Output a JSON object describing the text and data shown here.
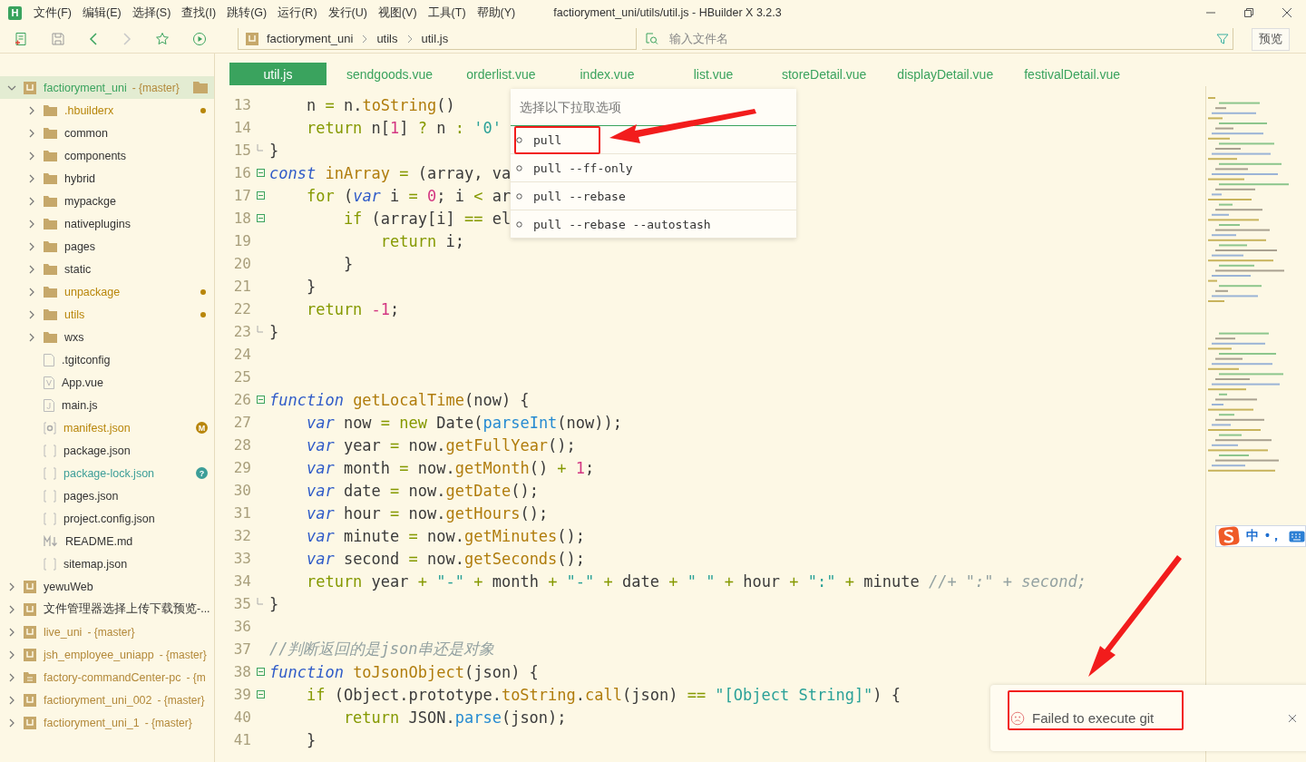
{
  "window": {
    "logo": "H",
    "title": "factioryment_uni/utils/util.js - HBuilder X 3.2.3",
    "menu": [
      "文件(F)",
      "编辑(E)",
      "选择(S)",
      "查找(I)",
      "跳转(G)",
      "运行(R)",
      "发行(U)",
      "视图(V)",
      "工具(T)",
      "帮助(Y)"
    ]
  },
  "toolbar": {
    "breadcrumb": [
      "factioryment_uni",
      "utils",
      "util.js"
    ],
    "search": {
      "placeholder": "输入文件名"
    },
    "preview_button": "预览"
  },
  "project_tree": [
    {
      "kind": "project",
      "label": "factioryment_uni",
      "branch": "- {master}",
      "git_repo": true,
      "selected": true,
      "expanded": true,
      "children": [
        {
          "kind": "folder",
          "label": ".hbuilderx",
          "modified": true,
          "expanded": false
        },
        {
          "kind": "folder",
          "label": "common",
          "modified": false,
          "expanded": false
        },
        {
          "kind": "folder",
          "label": "components",
          "modified": false,
          "expanded": false
        },
        {
          "kind": "folder",
          "label": "hybrid",
          "modified": false,
          "expanded": false
        },
        {
          "kind": "folder",
          "label": "mypackge",
          "modified": false,
          "expanded": false
        },
        {
          "kind": "folder",
          "label": "nativeplugins",
          "modified": false,
          "expanded": false
        },
        {
          "kind": "folder",
          "label": "pages",
          "modified": false,
          "expanded": false
        },
        {
          "kind": "folder",
          "label": "static",
          "modified": false,
          "expanded": false
        },
        {
          "kind": "folder",
          "label": "unpackage",
          "modified": true,
          "expanded": false
        },
        {
          "kind": "folder",
          "label": "utils",
          "modified": true,
          "expanded": false
        },
        {
          "kind": "folder",
          "label": "wxs",
          "modified": false,
          "expanded": false
        },
        {
          "kind": "file",
          "label": ".tgitconfig",
          "modified": false
        },
        {
          "kind": "vue",
          "label": "App.vue",
          "modified": false
        },
        {
          "kind": "js",
          "label": "main.js",
          "modified": false
        },
        {
          "kind": "config",
          "label": "manifest.json",
          "modified": true,
          "badge": "M"
        },
        {
          "kind": "json",
          "label": "package.json",
          "modified": false
        },
        {
          "kind": "json",
          "label": "package-lock.json",
          "untracked": true,
          "badge": "?"
        },
        {
          "kind": "json",
          "label": "pages.json",
          "modified": false
        },
        {
          "kind": "json",
          "label": "project.config.json",
          "modified": false
        },
        {
          "kind": "md",
          "label": "README.md",
          "modified": false
        },
        {
          "kind": "json",
          "label": "sitemap.json",
          "modified": false
        }
      ]
    },
    {
      "kind": "project",
      "label": "yewuWeb",
      "git_repo": false,
      "selected": false,
      "expanded": false
    },
    {
      "kind": "project",
      "label": "文件管理器选择上传下载预览-...",
      "git_repo": false,
      "selected": false,
      "expanded": false
    },
    {
      "kind": "project",
      "label": "live_uni",
      "branch": "- {master}",
      "git_repo": true,
      "selected": false,
      "expanded": false
    },
    {
      "kind": "project",
      "label": "jsh_employee_uniapp",
      "branch": "- {master}",
      "git_repo": true,
      "selected": false,
      "expanded": false
    },
    {
      "kind": "web-project",
      "label": "factory-commandCenter-pc",
      "branch": "- {m",
      "git_repo": true,
      "selected": false,
      "expanded": false
    },
    {
      "kind": "project",
      "label": "factioryment_uni_002",
      "branch": "- {master}",
      "git_repo": true,
      "selected": false,
      "expanded": false
    },
    {
      "kind": "project",
      "label": "factioryment_uni_1",
      "branch": "- {master}",
      "git_repo": true,
      "selected": false,
      "expanded": false
    }
  ],
  "tabs": [
    {
      "label": "util.js",
      "selected": true
    },
    {
      "label": "sendgoods.vue",
      "selected": false
    },
    {
      "label": "orderlist.vue",
      "selected": false
    },
    {
      "label": "index.vue",
      "selected": false
    },
    {
      "label": "list.vue",
      "selected": false
    },
    {
      "label": "storeDetail.vue",
      "selected": false
    },
    {
      "label": "displayDetail.vue",
      "selected": false
    },
    {
      "label": "festivalDetail.vue",
      "selected": false
    }
  ],
  "code": {
    "lines": [
      {
        "number": "13",
        "tokens": [
          {
            "kind": "plain",
            "text": "    n "
          },
          {
            "kind": "operator",
            "text": "= "
          },
          {
            "kind": "plain",
            "text": "n."
          },
          {
            "kind": "function",
            "text": "toString"
          },
          {
            "kind": "plain",
            "text": "()"
          }
        ]
      },
      {
        "number": "14",
        "tokens": [
          {
            "kind": "keyword",
            "text": "    return "
          },
          {
            "kind": "plain",
            "text": "n["
          },
          {
            "kind": "number",
            "text": "1"
          },
          {
            "kind": "plain",
            "text": "] "
          },
          {
            "kind": "operator",
            "text": "? "
          },
          {
            "kind": "plain",
            "text": "n "
          },
          {
            "kind": "operator",
            "text": ": "
          },
          {
            "kind": "string",
            "text": "'0'"
          }
        ]
      },
      {
        "number": "15",
        "block_end": true,
        "tokens": [
          {
            "kind": "plain",
            "text": "}"
          }
        ]
      },
      {
        "number": "16",
        "foldable": true,
        "tokens": [
          {
            "kind": "declaration",
            "text": "const "
          },
          {
            "kind": "function",
            "text": "inArray "
          },
          {
            "kind": "operator",
            "text": "= "
          },
          {
            "kind": "plain",
            "text": "(array, va"
          }
        ]
      },
      {
        "number": "17",
        "foldable": true,
        "tokens": [
          {
            "kind": "keyword",
            "text": "    for "
          },
          {
            "kind": "plain",
            "text": "("
          },
          {
            "kind": "declaration",
            "text": "var "
          },
          {
            "kind": "plain",
            "text": "i "
          },
          {
            "kind": "operator",
            "text": "= "
          },
          {
            "kind": "number",
            "text": "0"
          },
          {
            "kind": "plain",
            "text": "; i "
          },
          {
            "kind": "operator",
            "text": "< "
          },
          {
            "kind": "plain",
            "text": "ar"
          }
        ]
      },
      {
        "number": "18",
        "foldable": true,
        "tokens": [
          {
            "kind": "keyword",
            "text": "        if "
          },
          {
            "kind": "plain",
            "text": "(array[i] "
          },
          {
            "kind": "operator",
            "text": "== "
          },
          {
            "kind": "plain",
            "text": "el"
          }
        ]
      },
      {
        "number": "19",
        "tokens": [
          {
            "kind": "keyword",
            "text": "            return "
          },
          {
            "kind": "plain",
            "text": "i;"
          }
        ]
      },
      {
        "number": "20",
        "tokens": [
          {
            "kind": "plain",
            "text": "        }"
          }
        ]
      },
      {
        "number": "21",
        "tokens": [
          {
            "kind": "plain",
            "text": "    }"
          }
        ]
      },
      {
        "number": "22",
        "tokens": [
          {
            "kind": "keyword",
            "text": "    return "
          },
          {
            "kind": "number",
            "text": "-1"
          },
          {
            "kind": "plain",
            "text": ";"
          }
        ]
      },
      {
        "number": "23",
        "block_end": true,
        "tokens": [
          {
            "kind": "plain",
            "text": "}"
          }
        ]
      },
      {
        "number": "24"
      },
      {
        "number": "25"
      },
      {
        "number": "26",
        "foldable": true,
        "tokens": [
          {
            "kind": "declaration",
            "text": "function "
          },
          {
            "kind": "function",
            "text": "getLocalTime"
          },
          {
            "kind": "plain",
            "text": "(now) {"
          }
        ]
      },
      {
        "number": "27",
        "tokens": [
          {
            "kind": "declaration",
            "text": "    var "
          },
          {
            "kind": "plain",
            "text": "now "
          },
          {
            "kind": "operator",
            "text": "= "
          },
          {
            "kind": "keyword",
            "text": "new "
          },
          {
            "kind": "plain",
            "text": "Date("
          },
          {
            "kind": "builtin",
            "text": "parseInt"
          },
          {
            "kind": "plain",
            "text": "(now));"
          }
        ]
      },
      {
        "number": "28",
        "tokens": [
          {
            "kind": "declaration",
            "text": "    var "
          },
          {
            "kind": "plain",
            "text": "year "
          },
          {
            "kind": "operator",
            "text": "= "
          },
          {
            "kind": "plain",
            "text": "now."
          },
          {
            "kind": "function",
            "text": "getFullYear"
          },
          {
            "kind": "plain",
            "text": "();"
          }
        ]
      },
      {
        "number": "29",
        "tokens": [
          {
            "kind": "declaration",
            "text": "    var "
          },
          {
            "kind": "plain",
            "text": "month "
          },
          {
            "kind": "operator",
            "text": "= "
          },
          {
            "kind": "plain",
            "text": "now."
          },
          {
            "kind": "function",
            "text": "getMonth"
          },
          {
            "kind": "plain",
            "text": "() "
          },
          {
            "kind": "operator",
            "text": "+ "
          },
          {
            "kind": "number",
            "text": "1"
          },
          {
            "kind": "plain",
            "text": ";"
          }
        ]
      },
      {
        "number": "30",
        "tokens": [
          {
            "kind": "declaration",
            "text": "    var "
          },
          {
            "kind": "plain",
            "text": "date "
          },
          {
            "kind": "operator",
            "text": "= "
          },
          {
            "kind": "plain",
            "text": "now."
          },
          {
            "kind": "function",
            "text": "getDate"
          },
          {
            "kind": "plain",
            "text": "();"
          }
        ]
      },
      {
        "number": "31",
        "tokens": [
          {
            "kind": "declaration",
            "text": "    var "
          },
          {
            "kind": "plain",
            "text": "hour "
          },
          {
            "kind": "operator",
            "text": "= "
          },
          {
            "kind": "plain",
            "text": "now."
          },
          {
            "kind": "function",
            "text": "getHours"
          },
          {
            "kind": "plain",
            "text": "();"
          }
        ]
      },
      {
        "number": "32",
        "tokens": [
          {
            "kind": "declaration",
            "text": "    var "
          },
          {
            "kind": "plain",
            "text": "minute "
          },
          {
            "kind": "operator",
            "text": "= "
          },
          {
            "kind": "plain",
            "text": "now."
          },
          {
            "kind": "function",
            "text": "getMinutes"
          },
          {
            "kind": "plain",
            "text": "();"
          }
        ]
      },
      {
        "number": "33",
        "tokens": [
          {
            "kind": "declaration",
            "text": "    var "
          },
          {
            "kind": "plain",
            "text": "second "
          },
          {
            "kind": "operator",
            "text": "= "
          },
          {
            "kind": "plain",
            "text": "now."
          },
          {
            "kind": "function",
            "text": "getSeconds"
          },
          {
            "kind": "plain",
            "text": "();"
          }
        ]
      },
      {
        "number": "34",
        "tokens": [
          {
            "kind": "keyword",
            "text": "    return "
          },
          {
            "kind": "plain",
            "text": "year "
          },
          {
            "kind": "operator",
            "text": "+ "
          },
          {
            "kind": "string",
            "text": "\"-\" "
          },
          {
            "kind": "operator",
            "text": "+ "
          },
          {
            "kind": "plain",
            "text": "month "
          },
          {
            "kind": "operator",
            "text": "+ "
          },
          {
            "kind": "string",
            "text": "\"-\" "
          },
          {
            "kind": "operator",
            "text": "+ "
          },
          {
            "kind": "plain",
            "text": "date "
          },
          {
            "kind": "operator",
            "text": "+ "
          },
          {
            "kind": "string",
            "text": "\" \" "
          },
          {
            "kind": "operator",
            "text": "+ "
          },
          {
            "kind": "plain",
            "text": "hour "
          },
          {
            "kind": "operator",
            "text": "+ "
          },
          {
            "kind": "string",
            "text": "\":\" "
          },
          {
            "kind": "operator",
            "text": "+ "
          },
          {
            "kind": "plain",
            "text": "minute "
          },
          {
            "kind": "comment",
            "text": "//+ \":\" + second;"
          }
        ]
      },
      {
        "number": "35",
        "block_end": true,
        "tokens": [
          {
            "kind": "plain",
            "text": "}"
          }
        ]
      },
      {
        "number": "36"
      },
      {
        "number": "37",
        "tokens": [
          {
            "kind": "comment",
            "text": "//判断返回的是json串还是对象"
          }
        ]
      },
      {
        "number": "38",
        "foldable": true,
        "tokens": [
          {
            "kind": "declaration",
            "text": "function "
          },
          {
            "kind": "function",
            "text": "toJsonObject"
          },
          {
            "kind": "plain",
            "text": "(json) {"
          }
        ]
      },
      {
        "number": "39",
        "foldable": true,
        "tokens": [
          {
            "kind": "keyword",
            "text": "    if "
          },
          {
            "kind": "plain",
            "text": "(Object.prototype."
          },
          {
            "kind": "function",
            "text": "toString"
          },
          {
            "kind": "plain",
            "text": "."
          },
          {
            "kind": "function",
            "text": "call"
          },
          {
            "kind": "plain",
            "text": "(json) "
          },
          {
            "kind": "operator",
            "text": "== "
          },
          {
            "kind": "string",
            "text": "\"[Object String]\""
          },
          {
            "kind": "plain",
            "text": ") {"
          }
        ]
      },
      {
        "number": "40",
        "tokens": [
          {
            "kind": "keyword",
            "text": "        return "
          },
          {
            "kind": "plain",
            "text": "JSON."
          },
          {
            "kind": "builtin",
            "text": "parse"
          },
          {
            "kind": "plain",
            "text": "(json);"
          }
        ]
      },
      {
        "number": "41",
        "tokens": [
          {
            "kind": "plain",
            "text": "    }"
          }
        ]
      }
    ]
  },
  "pull_menu": {
    "placeholder": "选择以下拉取选项",
    "options": [
      "pull",
      "pull --ff-only",
      "pull --rebase",
      "pull --rebase --autostash"
    ]
  },
  "ime": {
    "mode": "中",
    "punctuation": "•，"
  },
  "notification": {
    "message": "Failed to execute git"
  }
}
